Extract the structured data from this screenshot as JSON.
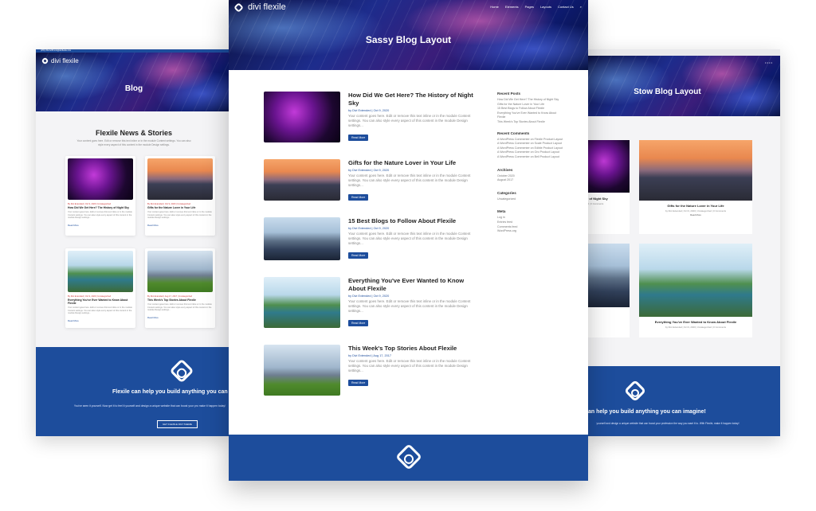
{
  "left": {
    "topbar": "(255) 352-6258   info@diviflexile.com",
    "logo": "divi flexile",
    "hero_title": "Blog",
    "section_title": "Flexile News & Stories",
    "section_text": "Your content goes here. Edit or remove this text inline or in the module Content settings. You can also style every aspect of this content in the module Design settings.",
    "cards": [
      {
        "meta": "By Divi Extended | Oct 9, 2020 | Uncategorized",
        "title": "How Did We Get Here? The History of Night Sky",
        "excerpt": "Your content goes here. Edit or remove this text inline or in the module Content settings. You can also style every aspect of this content in the module Design settings...",
        "more": "Read More",
        "img": "night"
      },
      {
        "meta": "By Divi Extended | Oct 9, 2020 | Uncategorized",
        "title": "Gifts for the Nature Lover in Your Life",
        "excerpt": "Your content goes here. Edit or remove this text inline or in the module Content settings. You can also style every aspect of this content in the module Design settings...",
        "more": "Read More",
        "img": "sunset"
      },
      {
        "meta": "By Divi Extended | Oct 9, 2020 | Uncategorized",
        "title": "Everything You've Ever Wanted to Know About Flexile",
        "excerpt": "Your content goes here. Edit or remove this text inline or in the module Content settings. You can also style every aspect of this content in the module Design settings...",
        "more": "Read More",
        "img": "couple"
      },
      {
        "meta": "By Divi Extended | Aug 17, 2017 | Uncategorized",
        "title": "This Week's Top Stories About Flexile",
        "excerpt": "Your content goes here. Edit or remove this text inline or in the module Content settings. You can also style every aspect of this content in the module Design settings...",
        "more": "Read More",
        "img": "city"
      }
    ],
    "footer_heading": "Flexile can help you build anything you can i",
    "footer_text": "You've seen it yourself. Now get it to feel it yourself and design a unique website that can boost your pro make it happen today!",
    "footer_button": "GET FLEXILE DIVI THEME"
  },
  "center": {
    "logo": "divi flexile",
    "nav": [
      "Home",
      "Elements",
      "Pages",
      "Layouts",
      "Contact Us"
    ],
    "hero_title": "Sassy Blog Layout",
    "posts": [
      {
        "title": "How Did We Get Here? The History of Night Sky",
        "meta": "by Divi Extended | Oct 9, 2020",
        "excerpt": "Your content goes here. Edit or remove this text inline or in the module Content settings. You can also style every aspect of this content in the module Design settings...",
        "button": "Read More",
        "img": "night"
      },
      {
        "title": "Gifts for the Nature Lover in Your Life",
        "meta": "by Divi Extended | Oct 9, 2020",
        "excerpt": "Your content goes here. Edit or remove this text inline or in the module Content settings. You can also style every aspect of this content in the module Design settings...",
        "button": "Read More",
        "img": "sunset"
      },
      {
        "title": "15 Best Blogs to Follow About Flexile",
        "meta": "by Divi Extended | Oct 9, 2020",
        "excerpt": "Your content goes here. Edit or remove this text inline or in the module Content settings. You can also style every aspect of this content in the module Design settings...",
        "button": "Read More",
        "img": "mtn"
      },
      {
        "title": "Everything You've Ever Wanted to Know About Flexile",
        "meta": "by Divi Extended | Oct 9, 2020",
        "excerpt": "Your content goes here. Edit or remove this text inline or in the module Content settings. You can also style every aspect of this content in the module Design settings...",
        "button": "Read More",
        "img": "couple"
      },
      {
        "title": "This Week's Top Stories About Flexile",
        "meta": "by Divi Extended | Aug 17, 2017",
        "excerpt": "Your content goes here. Edit or remove this text inline or in the module Content settings. You can also style every aspect of this content in the module Design settings...",
        "button": "Read More",
        "img": "city"
      }
    ],
    "sidebar": {
      "recent_posts_title": "Recent Posts",
      "recent_posts": [
        "How Did We Get Here? The History of Night Sky",
        "Gifts for the Nature Lover in Your Life",
        "15 Best Blogs to Follow About Flexile",
        "Everything You've Ever Wanted to Know About Flexile",
        "This Week's Top Stories About Flexile"
      ],
      "recent_comments_title": "Recent Comments",
      "recent_comments": [
        "A WordPress Commenter on Flexile Product Layout",
        "A WordPress Commenter on Scale Product Layout",
        "A WordPress Commenter on Edible Product Layout",
        "A WordPress Commenter on Oro Product Layout",
        "A WordPress Commenter on Bell Product Layout"
      ],
      "archives_title": "Archives",
      "archives": [
        "October 2020",
        "August 2017"
      ],
      "categories_title": "Categories",
      "categories": [
        "Uncategorized"
      ],
      "meta_title": "Meta",
      "meta": [
        "Log in",
        "Entries feed",
        "Comments feed",
        "WordPress.org"
      ]
    }
  },
  "right": {
    "hero_title": "Stow Blog Layout",
    "cards": [
      {
        "title": "Gifts for the Nature Lover in Your Life",
        "meta": "by Divi Extended | Oct 9, 2020 | Uncategorized | 0 Comments",
        "more": "Read More",
        "img": "sunset"
      },
      {
        "title": "Everything You've Ever Wanted to Know About Flexile",
        "meta": "by Divi Extended | Oct 9, 2020 | Uncategorized | 0 Comments",
        "more": "Read More",
        "img": "couple"
      }
    ],
    "partial_title": "y of Night Sky",
    "partial_meta": "ed | 0 Comments",
    "footer_heading": "an help you build anything you can imagine!",
    "footer_text": "yourself and design a unique website that can boost your profession the way you want it to. With Flexile, make it happen today!"
  },
  "colors": {
    "brand_blue": "#1d4d9c",
    "page_bg": "#f4f4f6"
  }
}
